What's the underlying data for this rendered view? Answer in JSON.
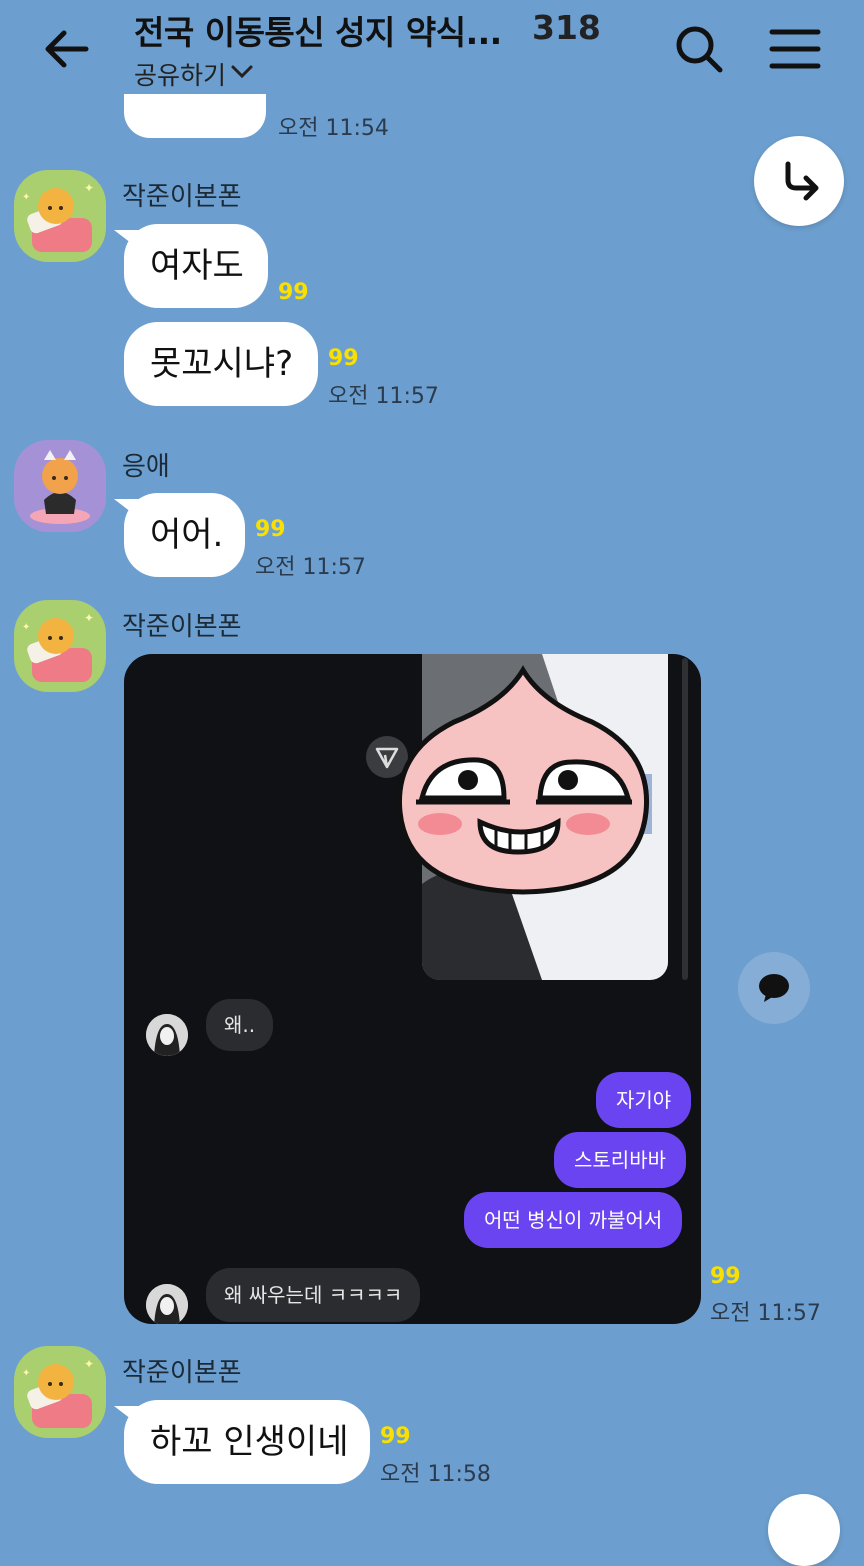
{
  "header": {
    "title": "전국 이동통신 성지 약식...",
    "member_count": "318",
    "share_label": "공유하기"
  },
  "messages": [
    {
      "time": "오전 11:54"
    },
    {
      "sender": "작준이본폰",
      "text": "여자도",
      "unread": "99"
    },
    {
      "text": "못꼬시냐?",
      "unread": "99",
      "time": "오전 11:57"
    },
    {
      "sender": "응애",
      "text": "어어.",
      "unread": "99",
      "time": "오전 11:57"
    },
    {
      "sender": "작준이본폰",
      "unread": "99",
      "time": "오전 11:57"
    },
    {
      "sender": "작준이본폰",
      "text": "하꼬 인생이네",
      "unread": "99",
      "time": "오전 11:58"
    }
  ],
  "screenshot": {
    "incoming_1": "왜..",
    "outgoing": [
      "자기야",
      "스토리바바",
      "어떤 병신이 까불어서"
    ],
    "incoming_2": "왜 싸우는데 ㅋㅋㅋㅋ"
  },
  "colors": {
    "background": "#6c9fcf",
    "unread": "#f9e000",
    "dm_outgoing": "#6a44f0"
  }
}
